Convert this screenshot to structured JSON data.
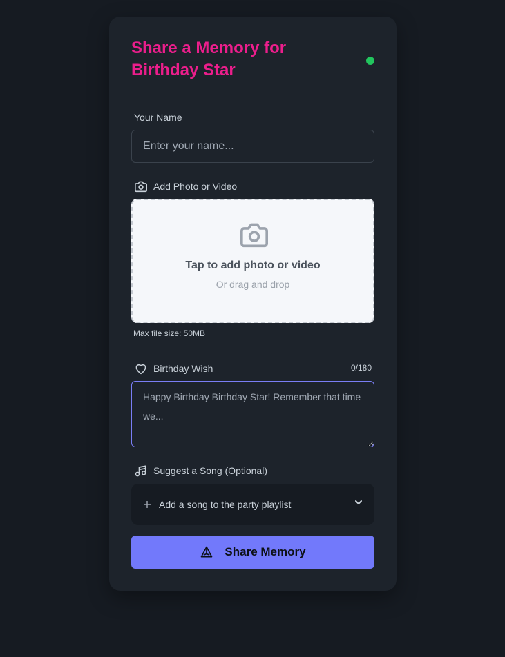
{
  "header": {
    "title": "Share a Memory for Birthday Star",
    "status_color": "#22c55e"
  },
  "name_field": {
    "label": "Your Name",
    "placeholder": "Enter your name...",
    "value": ""
  },
  "media": {
    "label": "Add Photo or Video",
    "label_icon": "camera-icon",
    "drop_title": "Tap to add photo or video",
    "drop_subtitle": "Or drag and drop",
    "max_size_note": "Max file size: 50MB"
  },
  "wish": {
    "label": "Birthday Wish",
    "label_icon": "heart-icon",
    "counter": "0/180",
    "placeholder": "Happy Birthday Birthday Star! Remember that time we...",
    "value": ""
  },
  "song": {
    "label": "Suggest a Song (Optional)",
    "label_icon": "music-note-icon",
    "add_label": "Add a song to the party playlist"
  },
  "submit": {
    "label": "Share Memory",
    "icon": "send-icon",
    "color": "#7279fb"
  },
  "colors": {
    "accent_title": "#ec1e8c",
    "background": "#161b22",
    "card": "#1d232b"
  }
}
